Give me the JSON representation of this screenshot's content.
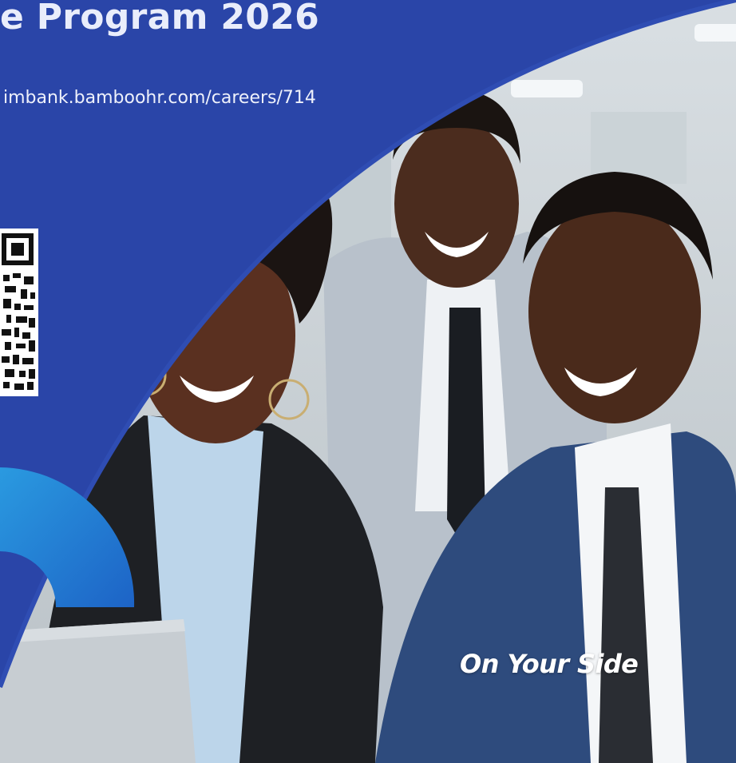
{
  "poster": {
    "title": "e Program 2026",
    "url": "imbank.bamboohr.com/careers/714",
    "tagline": "On Your Side"
  },
  "colors": {
    "brand_blue": "#2a45a8",
    "accent_arc": "#2a9ae0",
    "text_light": "#eef1fb"
  },
  "icons": {
    "qr": "qr-code-icon",
    "arc": "brand-arc-graphic"
  }
}
